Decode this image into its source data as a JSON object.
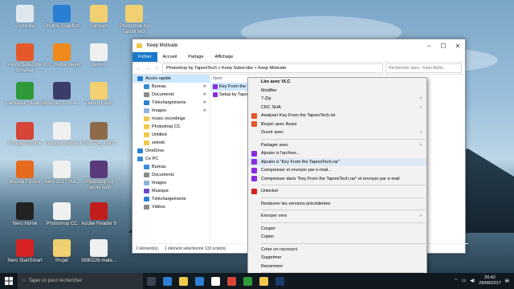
{
  "desktop": {
    "icons": [
      {
        "label": "Corbeille",
        "color": "#dfe7ef"
      },
      {
        "label": "Photos Snapfish",
        "color": "#2a7fd4"
      },
      {
        "label": "Safouen",
        "color": "#f0d070"
      },
      {
        "label": "Photoshop by TaponiTech",
        "color": "#f0d070"
      },
      {
        "label": "Avast SafeZone Browser",
        "color": "#e5582a"
      },
      {
        "label": "VLC media player",
        "color": "#f08a1c"
      },
      {
        "label": "zeineb",
        "color": "#f0f0f0"
      },
      {
        "label": "Camtasia Studio 8",
        "color": "#2f9a3a"
      },
      {
        "label": "Brushez.com-4...",
        "color": "#3c3c6a"
      },
      {
        "label": "Zeineb Flash",
        "color": "#f0d070"
      },
      {
        "label": "Google Chrome",
        "color": "#d64538"
      },
      {
        "label": "musique zeineb",
        "color": "#f0f0f0"
      },
      {
        "label": "17931704_1647...",
        "color": "#8d6b4a"
      },
      {
        "label": "Mozilla Firefox",
        "color": "#e56a1e"
      },
      {
        "label": "Nero 2017 Pla...",
        "color": "#f0f0f0"
      },
      {
        "label": "Photoshop by TaponiTech",
        "color": "#5a3a7a"
      },
      {
        "label": "Nero Home",
        "color": "#222222"
      },
      {
        "label": "Photoshop CC",
        "color": "#f0f0f0"
      },
      {
        "label": "Adobe Reader 9",
        "color": "#c21d1d"
      },
      {
        "label": "Nero StartSmart",
        "color": "#d62222"
      },
      {
        "label": "Projet",
        "color": "#f0d070"
      },
      {
        "label": "5690226-mate...",
        "color": "#f0f0f0"
      }
    ]
  },
  "window": {
    "title": "Keep Motivate",
    "ribbon_tabs": [
      "Fichier",
      "Accueil",
      "Partage",
      "Affichage"
    ],
    "address": [
      "Photoshop by TaponiTech",
      ">",
      "Keep Subscribe",
      ">",
      "Keep Motivate"
    ],
    "search_placeholder": "Rechercher dans : Keep Motiv...",
    "nav_items": [
      {
        "label": "Accès rapide",
        "level": "top",
        "icon": "#2a7fd4",
        "pin": ""
      },
      {
        "label": "Bureau",
        "level": "sub",
        "icon": "#3a8ad8",
        "pin": "✱"
      },
      {
        "label": "Documents",
        "level": "sub",
        "icon": "#8a8a8a",
        "pin": "✱"
      },
      {
        "label": "Téléchargements",
        "level": "sub",
        "icon": "#2a7fd4",
        "pin": "✱"
      },
      {
        "label": "Images",
        "level": "sub",
        "icon": "#8ab4d8",
        "pin": "✱"
      },
      {
        "label": "music recordings",
        "level": "sub",
        "icon": "#f0c850",
        "pin": ""
      },
      {
        "label": "Photoshop CC",
        "level": "sub",
        "icon": "#f0c850",
        "pin": ""
      },
      {
        "label": "Untitled",
        "level": "sub",
        "icon": "#f0c850",
        "pin": ""
      },
      {
        "label": "zeineb",
        "level": "sub",
        "icon": "#f0c850",
        "pin": ""
      },
      {
        "label": "OneDrive",
        "level": "top",
        "icon": "#2a7fd4",
        "pin": ""
      },
      {
        "label": "Ce PC",
        "level": "top",
        "icon": "#3a8ad8",
        "pin": ""
      },
      {
        "label": "Bureau",
        "level": "sub",
        "icon": "#3a8ad8",
        "pin": ""
      },
      {
        "label": "Documents",
        "level": "sub",
        "icon": "#8a8a8a",
        "pin": ""
      },
      {
        "label": "Images",
        "level": "sub",
        "icon": "#8ab4d8",
        "pin": ""
      },
      {
        "label": "Musique",
        "level": "sub",
        "icon": "#6a4ac8",
        "pin": ""
      },
      {
        "label": "Téléchargements",
        "level": "sub",
        "icon": "#2a7fd4",
        "pin": ""
      },
      {
        "label": "Vidéos",
        "level": "sub",
        "icon": "#8a8a8a",
        "pin": ""
      }
    ],
    "column_header": "Nom",
    "files": [
      {
        "label": "Key From the",
        "selected": true
      },
      {
        "label": "Setup by Tapo",
        "selected": false
      }
    ],
    "status": [
      "2 élément(s)",
      "1 élément sélectionné  133 octet(s)"
    ]
  },
  "context_menu": {
    "items": [
      {
        "label": "Lire avec VLC",
        "bold": true,
        "icon": "",
        "arrow": false,
        "sep_after": false
      },
      {
        "label": "Modifier",
        "bold": false,
        "icon": "",
        "arrow": false,
        "sep_after": false
      },
      {
        "label": "7-Zip",
        "bold": false,
        "icon": "",
        "arrow": true,
        "sep_after": false
      },
      {
        "label": "CRC SHA",
        "bold": false,
        "icon": "",
        "arrow": true,
        "sep_after": false
      },
      {
        "label": "Analyser Key From the TaponiTech.txt",
        "bold": false,
        "icon": "#e5582a",
        "arrow": false,
        "sep_after": false
      },
      {
        "label": "Broyer avec Avast",
        "bold": false,
        "icon": "#e5582a",
        "arrow": false,
        "sep_after": false
      },
      {
        "label": "Ouvrir avec",
        "bold": false,
        "icon": "",
        "arrow": true,
        "sep_after": true
      },
      {
        "label": "Partager avec",
        "bold": false,
        "icon": "",
        "arrow": true,
        "sep_after": false
      },
      {
        "label": "Ajouter à l'archive...",
        "bold": false,
        "icon": "#8a2be2",
        "arrow": false,
        "sep_after": false
      },
      {
        "label": "Ajouter à \"Key From the TaponiTech.rar\"",
        "bold": false,
        "icon": "#8a2be2",
        "arrow": false,
        "sep_after": false,
        "highlight": true
      },
      {
        "label": "Compresser et envoyer par e-mail...",
        "bold": false,
        "icon": "#8a2be2",
        "arrow": false,
        "sep_after": false
      },
      {
        "label": "Compresser dans \"Key From the TaponiTech.rar\" et envoyer par e-mail",
        "bold": false,
        "icon": "#8a2be2",
        "arrow": false,
        "sep_after": true
      },
      {
        "label": "Unlocker",
        "bold": false,
        "icon": "#d62222",
        "arrow": false,
        "sep_after": true
      },
      {
        "label": "Restaurer les versions précédentes",
        "bold": false,
        "icon": "",
        "arrow": false,
        "sep_after": true
      },
      {
        "label": "Envoyer vers",
        "bold": false,
        "icon": "",
        "arrow": true,
        "sep_after": true
      },
      {
        "label": "Couper",
        "bold": false,
        "icon": "",
        "arrow": false,
        "sep_after": false
      },
      {
        "label": "Copier",
        "bold": false,
        "icon": "",
        "arrow": false,
        "sep_after": true
      },
      {
        "label": "Créer un raccourci",
        "bold": false,
        "icon": "",
        "arrow": false,
        "sep_after": false
      },
      {
        "label": "Supprimer",
        "bold": false,
        "icon": "",
        "arrow": false,
        "sep_after": false
      },
      {
        "label": "Renommer",
        "bold": false,
        "icon": "",
        "arrow": false,
        "sep_after": true
      },
      {
        "label": "Propriétés",
        "bold": false,
        "icon": "",
        "arrow": false,
        "sep_after": false
      }
    ]
  },
  "taskbar": {
    "search_placeholder": "Taper ici pour rechercher",
    "apps": [
      {
        "name": "task-view",
        "color": "#3a4450"
      },
      {
        "name": "edge",
        "color": "#2a7fd4"
      },
      {
        "name": "file-explorer",
        "color": "#f0c850"
      },
      {
        "name": "store",
        "color": "#2a7fd4"
      },
      {
        "name": "hp",
        "color": "#ffffff"
      },
      {
        "name": "chrome",
        "color": "#d64538"
      },
      {
        "name": "camtasia",
        "color": "#2f9a3a"
      },
      {
        "name": "explorer-2",
        "color": "#f0c850"
      },
      {
        "name": "photoshop",
        "color": "#1c3a6a"
      }
    ],
    "time": "20:42",
    "date": "29/08/2017"
  }
}
